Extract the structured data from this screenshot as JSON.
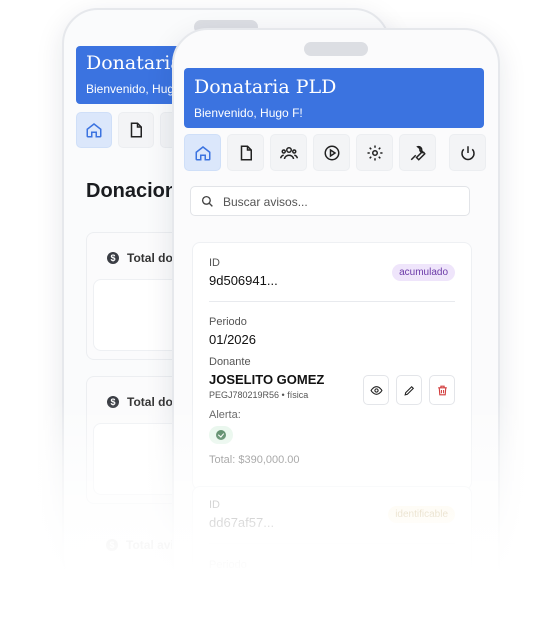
{
  "back": {
    "header": {
      "title": "Donataria PLD",
      "subtitle": "Bienvenido, Hugo F!"
    },
    "section_title": "Donaciones",
    "cards": [
      {
        "label": "Total donaciones"
      },
      {
        "label": "Total donaciones"
      },
      {
        "label": "Total avisos"
      }
    ]
  },
  "front": {
    "header": {
      "title": "Donataria PLD",
      "subtitle": "Bienvenido, Hugo F!"
    },
    "nav": [
      {
        "icon": "home-icon",
        "active": true
      },
      {
        "icon": "document-icon"
      },
      {
        "icon": "users-icon"
      },
      {
        "icon": "play-icon"
      },
      {
        "icon": "settings-icon"
      },
      {
        "icon": "wrench-icon"
      },
      {
        "icon": "power-icon"
      }
    ],
    "search": {
      "placeholder": "Buscar avisos..."
    },
    "records": [
      {
        "id_label": "ID",
        "id": "9d506941...",
        "status": "acumulado",
        "period_label": "Periodo",
        "period": "01/2026",
        "donor_label": "Donante",
        "donor_name": "JOSELITO GOMEZ",
        "donor_meta": "PEGJ780219R56 • física",
        "alert_label": "Alerta:",
        "total": "Total: $390,000.00"
      },
      {
        "id_label": "ID",
        "id": "dd67af57...",
        "status": "identificable",
        "period_label": "Periodo"
      }
    ]
  },
  "colors": {
    "accent": "#3b73e0",
    "status_acumulado": "#efe5fb",
    "status_identificable": "#fdf3d8",
    "delete": "#d23c3c"
  }
}
